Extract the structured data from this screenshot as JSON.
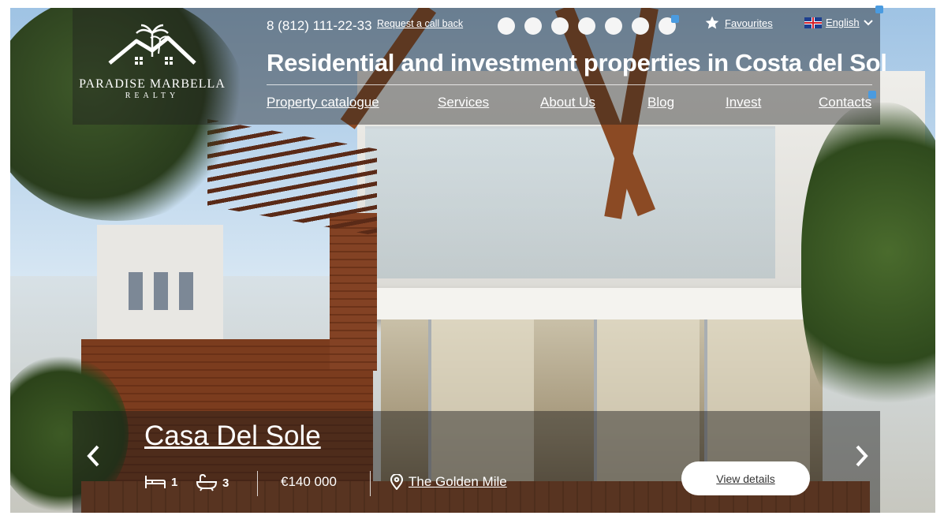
{
  "header": {
    "logo": {
      "name": "Paradise Marbella",
      "sub": "Realty"
    },
    "phone": "8 (812) 111-22-33",
    "callback_label": "Request a call back",
    "favourites_label": "Favourites",
    "language_label": "English",
    "headline": "Residential and investment properties in Costa del Sol",
    "nav": [
      "Property catalogue",
      "Services",
      "About Us",
      "Blog",
      "Invest",
      "Contacts"
    ]
  },
  "slider": {
    "dot_count": 7
  },
  "listing": {
    "title": "Casa Del Sole",
    "bedrooms": "1",
    "bathrooms": "3",
    "price": "€140 000",
    "location": "The Golden Mile",
    "view_label": "View details"
  },
  "icons": {
    "prev": "chevron-left-icon",
    "next": "chevron-right-icon",
    "bed": "bed-icon",
    "bath": "bathtub-icon",
    "location": "map-pin-icon",
    "favourite": "star-icon",
    "language": "uk-flag-icon",
    "dropdown": "chevron-down-icon"
  }
}
